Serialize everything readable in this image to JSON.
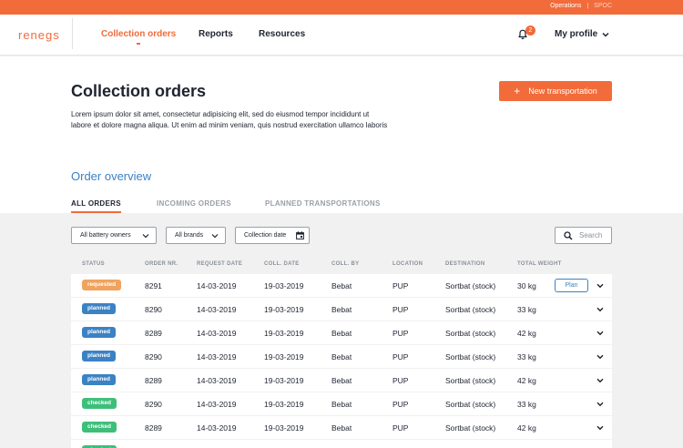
{
  "topbar": {
    "link_operations": "Operations",
    "separator": "|",
    "link_spoc": "SPOC"
  },
  "nav": {
    "logo": "renegs",
    "items": [
      {
        "label": "Collection orders",
        "active": true
      },
      {
        "label": "Reports",
        "active": false
      },
      {
        "label": "Resources",
        "active": false
      }
    ],
    "notifications_count": "2",
    "profile_label": "My profile"
  },
  "page": {
    "title": "Collection orders",
    "description": "Lorem ipsum dolor sit amet, consectetur adipisicing elit, sed do eiusmod tempor incididunt ut labore et dolore magna aliqua. Ut enim ad minim veniam, quis nostrud exercitation ullamco laboris",
    "new_button": "New transportation",
    "section_title": "Order overview"
  },
  "tabs": [
    {
      "label": "ALL ORDERS",
      "active": true
    },
    {
      "label": "INCOMING ORDERS",
      "active": false
    },
    {
      "label": "PLANNED TRANSPORTATIONS",
      "active": false
    }
  ],
  "filters": {
    "battery_owners": "All battery owners",
    "brands": "All brands",
    "collection_date": "Collection date",
    "search_placeholder": "Search"
  },
  "table": {
    "headers": [
      "STATUS",
      "ORDER NR.",
      "REQUEST DATE",
      "COLL. DATE",
      "COLL. BY",
      "LOCATION",
      "DESTINATION",
      "TOTAL WEIGHT"
    ],
    "plan_label": "Plan",
    "status_colors": {
      "requested": "#f0a35e",
      "planned": "#3b82c4",
      "checked": "#3dbf7a"
    },
    "rows": [
      {
        "status": "requested",
        "order": "8291",
        "request_date": "14-03-2019",
        "coll_date": "19-03-2019",
        "coll_by": "Bebat",
        "location": "PUP",
        "destination": "Sortbat (stock)",
        "weight": "30 kg",
        "show_plan": true
      },
      {
        "status": "planned",
        "order": "8290",
        "request_date": "14-03-2019",
        "coll_date": "19-03-2019",
        "coll_by": "Bebat",
        "location": "PUP",
        "destination": "Sortbat (stock)",
        "weight": "33 kg",
        "show_plan": false
      },
      {
        "status": "planned",
        "order": "8289",
        "request_date": "14-03-2019",
        "coll_date": "19-03-2019",
        "coll_by": "Bebat",
        "location": "PUP",
        "destination": "Sortbat (stock)",
        "weight": "42 kg",
        "show_plan": false
      },
      {
        "status": "planned",
        "order": "8290",
        "request_date": "14-03-2019",
        "coll_date": "19-03-2019",
        "coll_by": "Bebat",
        "location": "PUP",
        "destination": "Sortbat (stock)",
        "weight": "33 kg",
        "show_plan": false
      },
      {
        "status": "planned",
        "order": "8289",
        "request_date": "14-03-2019",
        "coll_date": "19-03-2019",
        "coll_by": "Bebat",
        "location": "PUP",
        "destination": "Sortbat (stock)",
        "weight": "42 kg",
        "show_plan": false
      },
      {
        "status": "checked",
        "order": "8290",
        "request_date": "14-03-2019",
        "coll_date": "19-03-2019",
        "coll_by": "Bebat",
        "location": "PUP",
        "destination": "Sortbat (stock)",
        "weight": "33 kg",
        "show_plan": false
      },
      {
        "status": "checked",
        "order": "8289",
        "request_date": "14-03-2019",
        "coll_date": "19-03-2019",
        "coll_by": "Bebat",
        "location": "PUP",
        "destination": "Sortbat (stock)",
        "weight": "42 kg",
        "show_plan": false
      },
      {
        "status": "checked",
        "order": "",
        "request_date": "",
        "coll_date": "",
        "coll_by": "",
        "location": "",
        "destination": "",
        "weight": "",
        "show_plan": false
      }
    ]
  }
}
